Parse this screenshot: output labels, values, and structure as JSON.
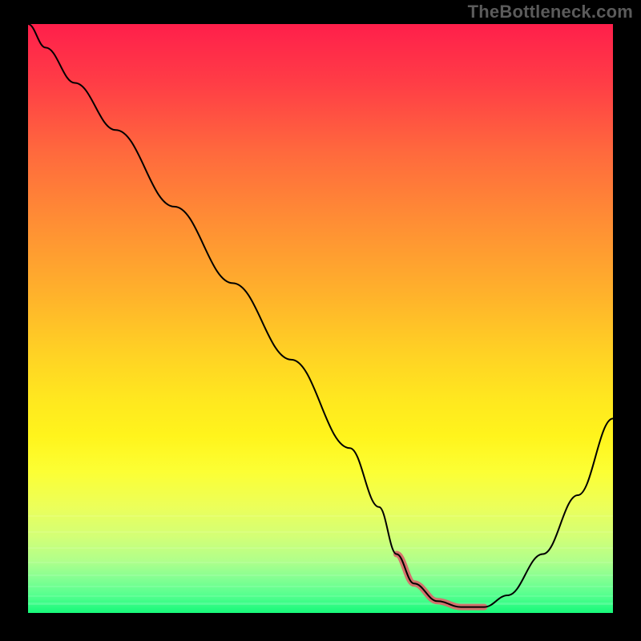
{
  "watermark": "TheBottleneck.com",
  "colors": {
    "background": "#000000",
    "curve_stroke": "#000000",
    "highlight_stroke": "#d96a6a",
    "gradient_top": "#ff1f4b",
    "gradient_bottom": "#17f97a"
  },
  "chart_data": {
    "type": "line",
    "title": "",
    "xlabel": "",
    "ylabel": "",
    "xlim": [
      0,
      100
    ],
    "ylim": [
      0,
      100
    ],
    "grid": false,
    "legend": false,
    "series": [
      {
        "name": "bottleneck-curve",
        "x": [
          0,
          3,
          8,
          15,
          25,
          35,
          45,
          55,
          60,
          63,
          66,
          70,
          74,
          78,
          82,
          88,
          94,
          100
        ],
        "values": [
          100,
          96,
          90,
          82,
          69,
          56,
          43,
          28,
          18,
          10,
          5,
          2,
          1,
          1,
          3,
          10,
          20,
          33
        ]
      },
      {
        "name": "optimal-range-highlight",
        "x": [
          63,
          66,
          70,
          74,
          78
        ],
        "values": [
          10,
          5,
          2,
          1,
          1
        ]
      }
    ],
    "annotations": []
  }
}
